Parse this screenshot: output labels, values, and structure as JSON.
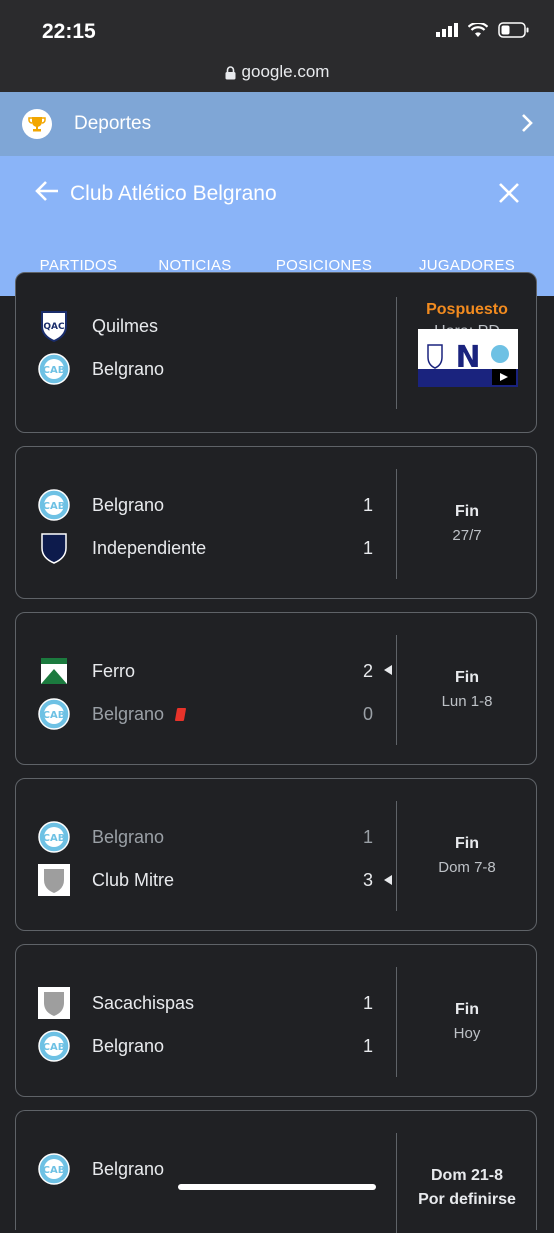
{
  "status_bar": {
    "time": "22:15"
  },
  "browser": {
    "url": "google.com"
  },
  "section": {
    "label": "Deportes"
  },
  "header": {
    "title": "Club Atlético Belgrano",
    "tabs": [
      "PARTIDOS",
      "NOTICIAS",
      "POSICIONES",
      "JUGADORES"
    ],
    "active_tab": "PARTIDOS"
  },
  "colors": {
    "header_bg": "#8ab4f8",
    "section_bg": "#7fa6d6",
    "postponed": "#f28b1f",
    "red_card": "#e8332a"
  },
  "matches": [
    {
      "home": "Quilmes",
      "away": "Belgrano",
      "status": "Pospuesto",
      "detail": "Hora: PD",
      "has_video": true
    },
    {
      "home": "Belgrano",
      "home_score": "1",
      "away": "Independiente",
      "away_score": "1",
      "status": "Fin",
      "detail": "27/7"
    },
    {
      "home": "Ferro",
      "home_score": "2",
      "away": "Belgrano",
      "away_score": "0",
      "status": "Fin",
      "detail": "Lun 1-8",
      "winner": "home",
      "red_card": "away"
    },
    {
      "home": "Belgrano",
      "home_score": "1",
      "away": "Club Mitre",
      "away_score": "3",
      "status": "Fin",
      "detail": "Dom 7-8",
      "winner": "away"
    },
    {
      "home": "Sacachispas",
      "home_score": "1",
      "away": "Belgrano",
      "away_score": "1",
      "status": "Fin",
      "detail": "Hoy"
    },
    {
      "home": "Belgrano",
      "status": "Dom 21-8",
      "detail": "Por definirse"
    }
  ]
}
